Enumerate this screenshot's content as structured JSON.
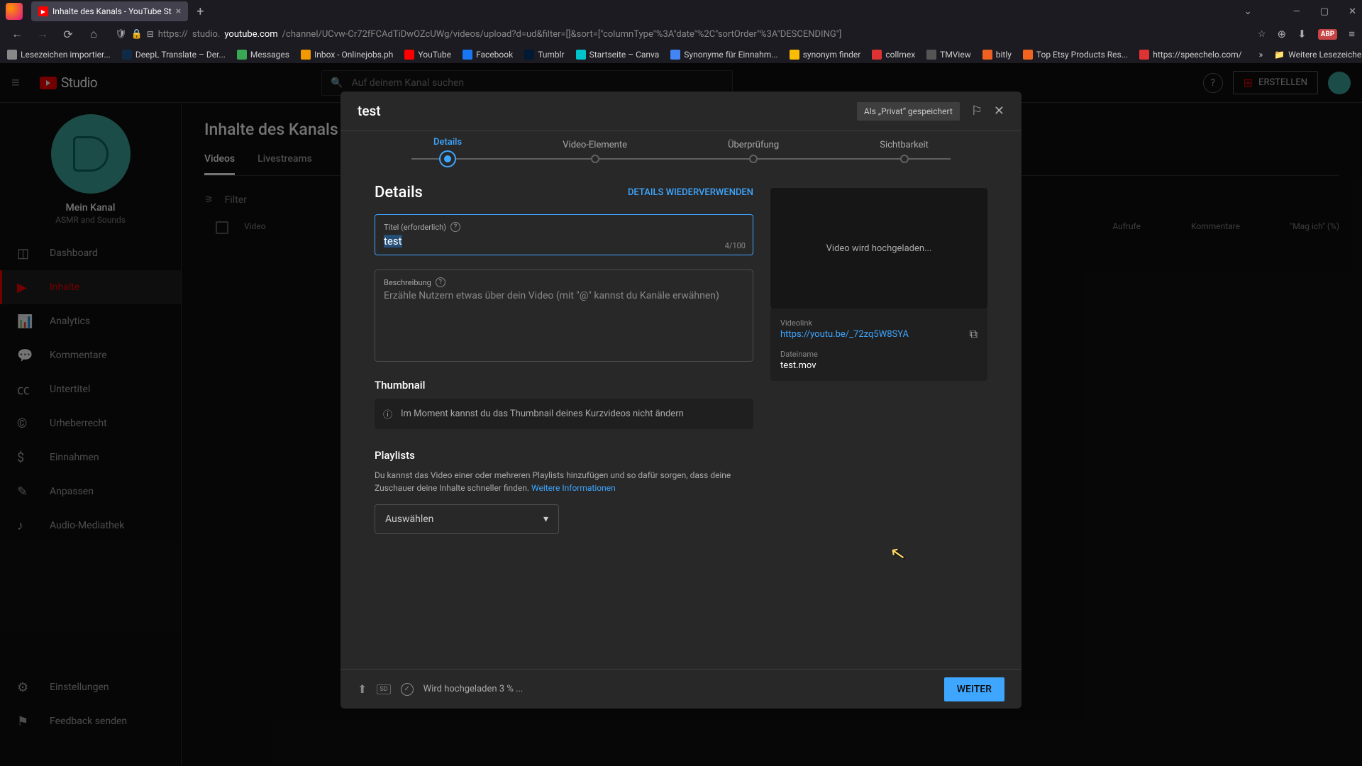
{
  "browser": {
    "tab_title": "Inhalte des Kanals - YouTube St",
    "url_protocol": "https://",
    "url_prefix": "studio.",
    "url_domain": "youtube.com",
    "url_path": "/channel/UCvw-Cr72fFCAdTiDwOZcUWg/videos/upload?d=ud&filter=[]&sort=[\"columnType\"%3A\"date\"%2C\"sortOrder\"%3A\"DESCENDING\"]",
    "bookmarks": [
      {
        "label": "Lesezeichen importier...",
        "color": "#888"
      },
      {
        "label": "DeepL Translate – Der...",
        "color": "#0f2b46"
      },
      {
        "label": "Messages",
        "color": "#3aa757"
      },
      {
        "label": "Inbox - Onlinejobs.ph",
        "color": "#f29900"
      },
      {
        "label": "YouTube",
        "color": "#f00"
      },
      {
        "label": "Facebook",
        "color": "#1877f2"
      },
      {
        "label": "Tumblr",
        "color": "#001935"
      },
      {
        "label": "Startseite – Canva",
        "color": "#00c4cc"
      },
      {
        "label": "Synonyme für Einnahm...",
        "color": "#4285f4"
      },
      {
        "label": "synonym finder",
        "color": "#fbbc04"
      },
      {
        "label": "collmex",
        "color": "#d33"
      },
      {
        "label": "TMView",
        "color": "#555"
      },
      {
        "label": "bitly",
        "color": "#ee6123"
      },
      {
        "label": "Top Etsy Products Res...",
        "color": "#f1641e"
      },
      {
        "label": "https://speechelo.com/",
        "color": "#d33"
      }
    ],
    "more_bookmarks": "Weitere Lesezeichen"
  },
  "studio": {
    "logo": "Studio",
    "search_placeholder": "Auf deinem Kanal suchen",
    "create_btn": "ERSTELLEN",
    "channel_name": "Mein Kanal",
    "channel_sub": "ASMR and Sounds",
    "nav": {
      "dashboard": "Dashboard",
      "content": "Inhalte",
      "analytics": "Analytics",
      "comments": "Kommentare",
      "subtitles": "Untertitel",
      "copyright": "Urheberrecht",
      "earn": "Einnahmen",
      "customize": "Anpassen",
      "audio": "Audio-Mediathek",
      "settings": "Einstellungen",
      "feedback": "Feedback senden"
    },
    "page_title": "Inhalte des Kanals",
    "tabs": {
      "videos": "Videos",
      "live": "Livestreams"
    },
    "filter": "Filter",
    "columns": {
      "video": "Video",
      "views": "Aufrufe",
      "comments": "Kommentare",
      "likes": "\"Mag ich\" (%)"
    }
  },
  "modal": {
    "title": "test",
    "saved": "Als „Privat“ gespeichert",
    "steps": {
      "details": "Details",
      "elements": "Video-Elemente",
      "checks": "Überprüfung",
      "visibility": "Sichtbarkeit"
    },
    "details_heading": "Details",
    "reuse": "DETAILS WIEDERVERWENDEN",
    "title_label": "Titel (erforderlich)",
    "title_value": "test",
    "title_count": "4/100",
    "desc_label": "Beschreibung",
    "desc_placeholder": "Erzähle Nutzern etwas über dein Video (mit \"@\" kannst du Kanäle erwähnen)",
    "thumbnail_heading": "Thumbnail",
    "thumbnail_info": "Im Moment kannst du das Thumbnail deines Kurzvideos nicht ändern",
    "playlists_heading": "Playlists",
    "playlists_desc": "Du kannst das Video einer oder mehreren Playlists hinzufügen und so dafür sorgen, dass deine Zuschauer deine Inhalte schneller finden. ",
    "playlists_more": "Weitere Informationen",
    "playlists_select": "Auswählen",
    "preview_status": "Video wird hochgeladen...",
    "videolink_label": "Videolink",
    "videolink": "https://youtu.be/_72zq5W8SYA",
    "filename_label": "Dateiname",
    "filename": "test.mov",
    "upload_status": "Wird hochgeladen 3 % ...",
    "next": "WEITER"
  }
}
